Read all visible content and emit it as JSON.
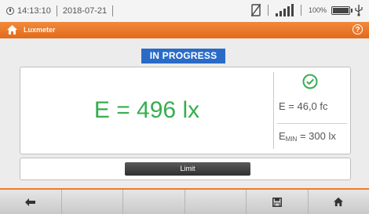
{
  "status": {
    "time": "14:13:10",
    "date": "2018-07-21",
    "battery_percent": "100%"
  },
  "titlebar": {
    "title": "Luxmeter",
    "help_glyph": "?"
  },
  "progress": {
    "label": "IN PROGRESS"
  },
  "result": {
    "main_value": "E = 496 lx",
    "fc_value": "E = 46,0 fc",
    "emin_prefix": "E",
    "emin_sub": "MIN",
    "emin_value": " = 300 lx"
  },
  "limit": {
    "button_label": "Limit"
  },
  "icons": {
    "accent": "#e36a1c",
    "ok_color": "#38ad4f",
    "badge_color": "#2a6bc7"
  }
}
